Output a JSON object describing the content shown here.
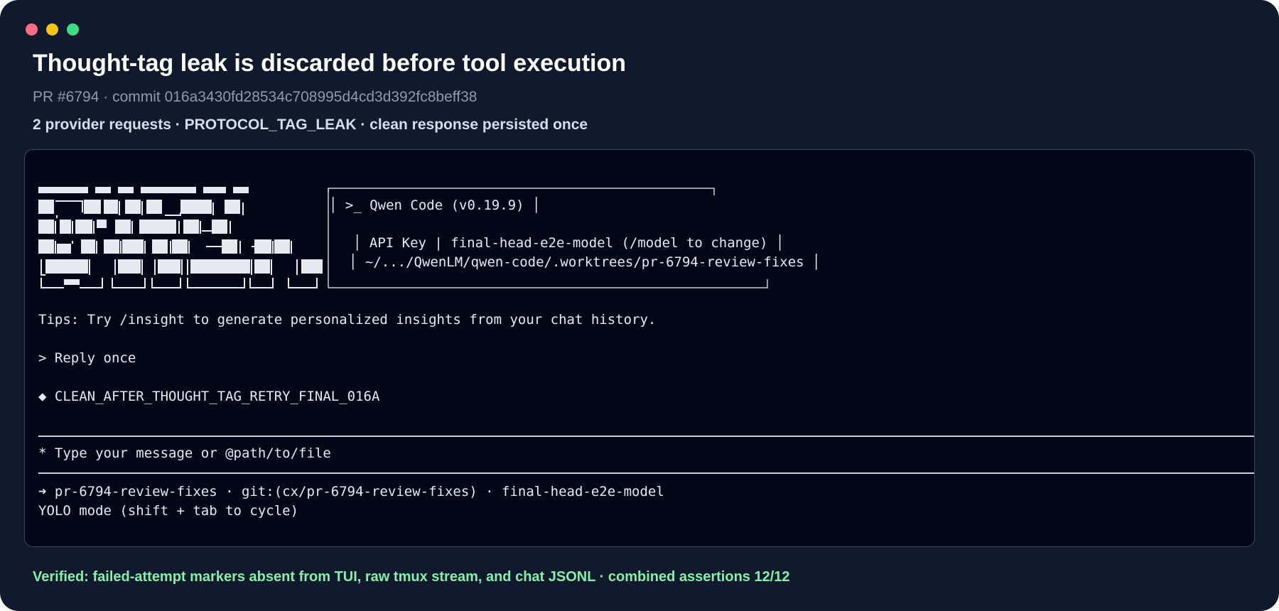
{
  "window": {
    "controls": [
      "close",
      "minimize",
      "zoom"
    ]
  },
  "header": {
    "title": "Thought-tag leak is discarded before tool execution",
    "subtitle": "PR #6794 · commit 016a3430fd28534c708995d4cd3d392fc8beff38",
    "summary": "2 provider requests · PROTOCOL_TAG_LEAK · clean response persisted once"
  },
  "terminal": {
    "app_line": "│ >_ Qwen Code (v0.19.9) │",
    "auth_line": "│ API Key | final-head-e2e-model (/model to change) │",
    "path_line": "│ ~/.../QwenLM/qwen-code/.worktrees/pr-6794-review-fixes │",
    "tips": "Tips: Try /insight to generate personalized insights from your chat history.",
    "user_prompt": "> Reply once",
    "assistant_response": "◆ CLEAN_AFTER_THOUGHT_TAG_RETRY_FINAL_016A",
    "input_placeholder": "* Type your message or @path/to/file",
    "status_line": "➜ pr-6794-review-fixes · git:(cx/pr-6794-review-fixes) · final-head-e2e-model",
    "mode_line": "YOLO mode (shift + tab to cycle)"
  },
  "footer": {
    "verified": "Verified: failed-attempt markers absent from TUI, raw tmux stream, and chat JSONL · combined assertions 12/12"
  },
  "colors": {
    "window_bg": "#111a2d",
    "terminal_bg": "#020617",
    "success": "#86efac",
    "close": "#ff6b81",
    "minimize": "#f5c518",
    "zoom": "#3ddc84"
  }
}
